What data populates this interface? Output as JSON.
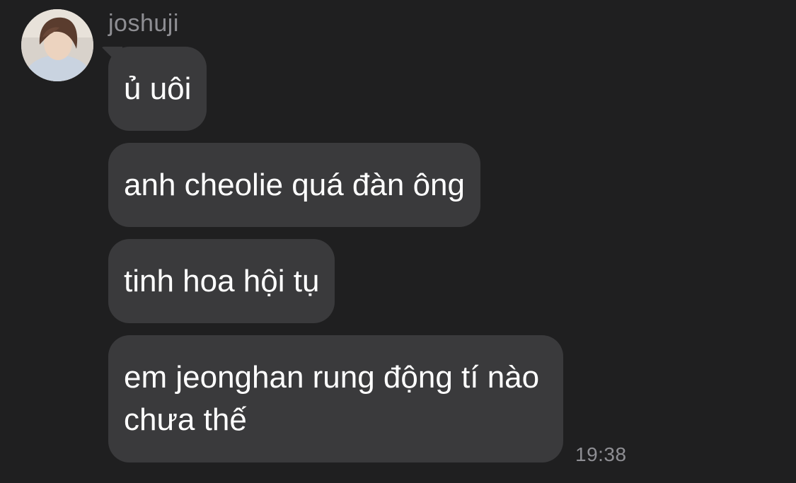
{
  "chat": {
    "sender": "joshuji",
    "messages": [
      {
        "text": "ủ uôi"
      },
      {
        "text": "anh cheolie quá đàn ông"
      },
      {
        "text": "tinh hoa hội tụ"
      },
      {
        "text": "em jeonghan rung động tí nào chưa thế"
      }
    ],
    "timestamp": "19:38"
  },
  "colors": {
    "background": "#1f1f20",
    "bubble": "#3a3a3c",
    "text": "#ffffff",
    "meta": "#8e8e93"
  }
}
